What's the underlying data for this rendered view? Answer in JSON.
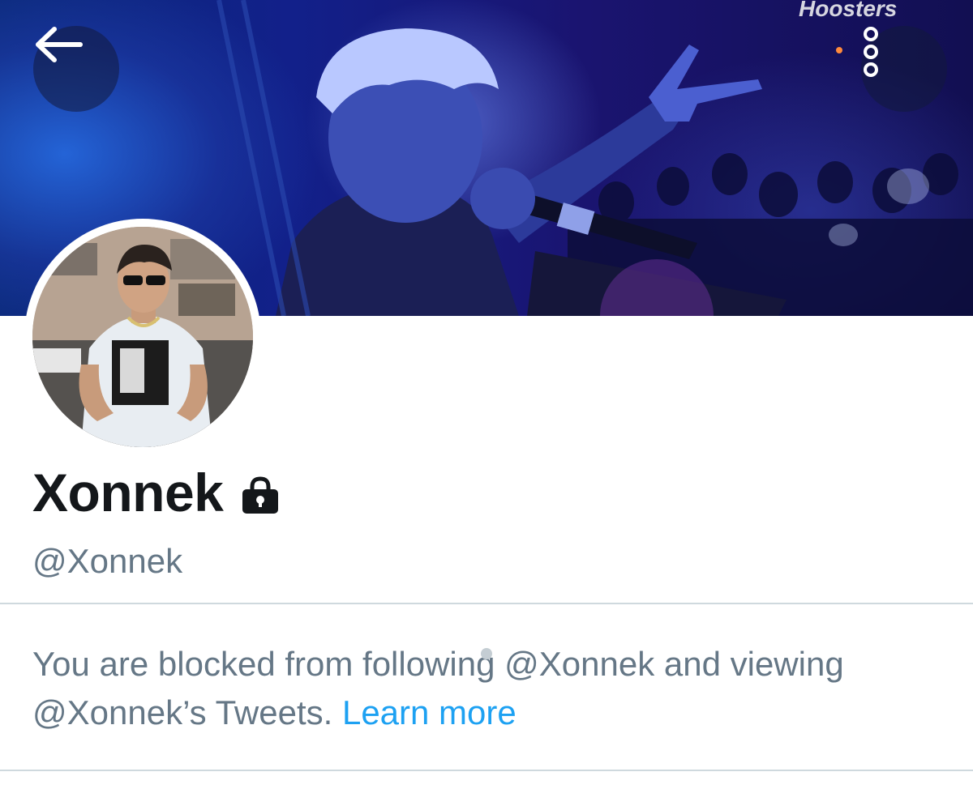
{
  "header": {
    "back_icon": "arrow-left-icon",
    "more_icon": "vertical-dots-icon",
    "banner_logo_text": "Hoosters"
  },
  "profile": {
    "display_name": "Xonnek",
    "protected_icon": "lock-icon",
    "handle": "@Xonnek"
  },
  "blocked_notice": {
    "text": "You are blocked from following @Xonnek and viewing @Xonnek’s Tweets.",
    "link_label": "Learn more"
  },
  "colors": {
    "text_primary": "#14171a",
    "text_secondary": "#657786",
    "link": "#1da1f2",
    "divider": "#cfd9de"
  }
}
